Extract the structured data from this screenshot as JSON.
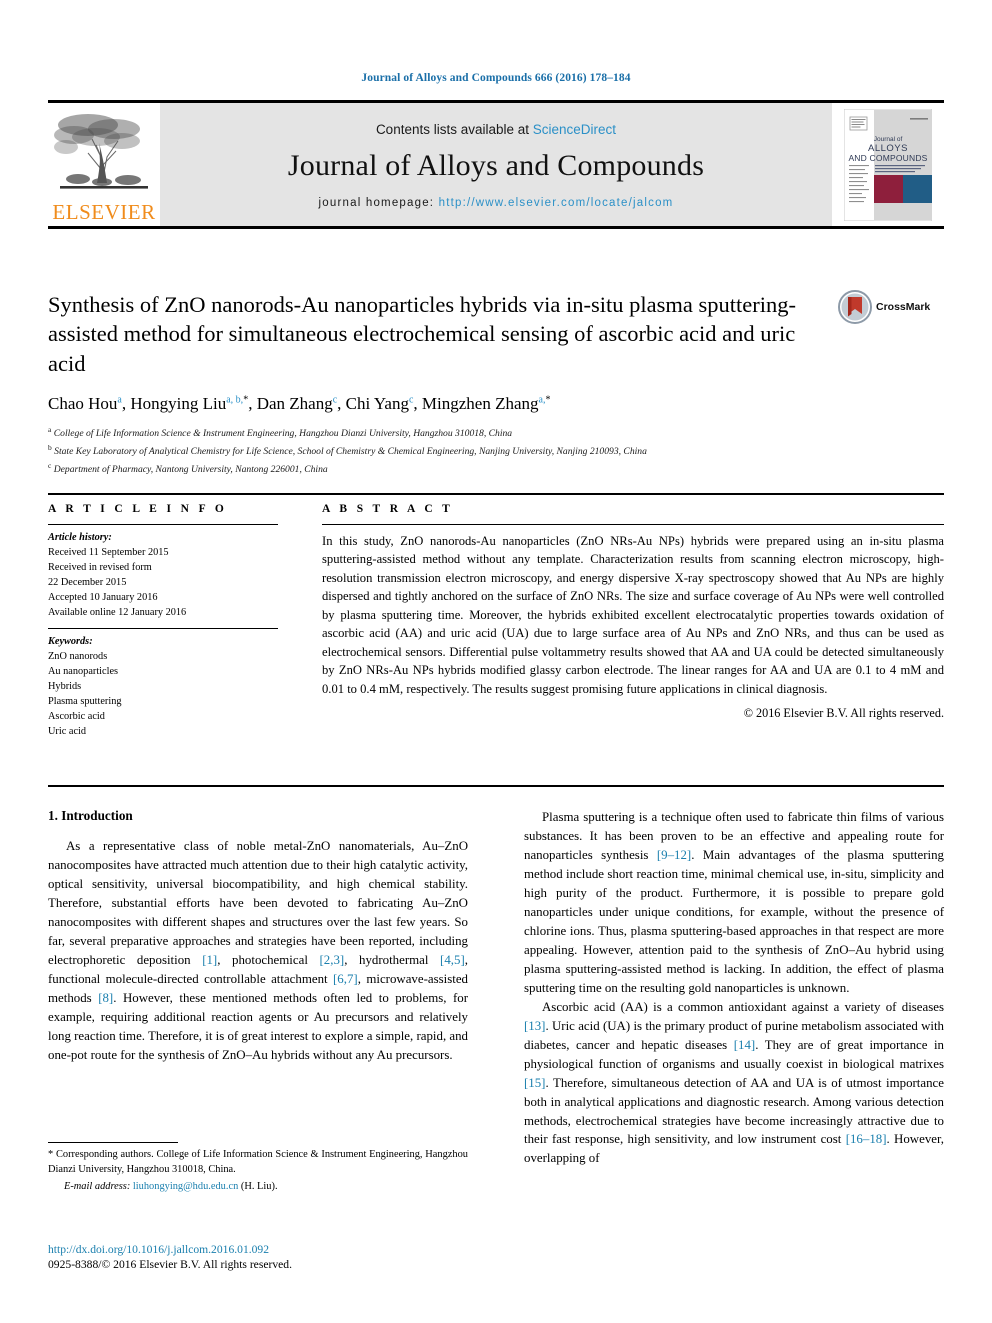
{
  "running_head": "Journal of Alloys and Compounds 666 (2016) 178–184",
  "masthead": {
    "publisher": "ELSEVIER",
    "contents_prefix": "Contents lists available at ",
    "contents_link": "ScienceDirect",
    "journal_title": "Journal of Alloys and Compounds",
    "homepage_label": "journal homepage: ",
    "homepage_url": "http://www.elsevier.com/locate/jalcom",
    "cover": {
      "line1": "Journal of",
      "line2": "ALLOYS",
      "line3": "AND COMPOUNDS"
    }
  },
  "article": {
    "title": "Synthesis of ZnO nanorods-Au nanoparticles hybrids via in-situ plasma sputtering-assisted method for simultaneous electrochemical sensing of ascorbic acid and uric acid",
    "crossmark_label": "CrossMark",
    "authors": [
      {
        "name": "Chao Hou",
        "sup": "a",
        "star": false
      },
      {
        "name": "Hongying Liu",
        "sup": "a, b,",
        "star": true
      },
      {
        "name": "Dan Zhang",
        "sup": "c",
        "star": false
      },
      {
        "name": "Chi Yang",
        "sup": "c",
        "star": false
      },
      {
        "name": "Mingzhen Zhang",
        "sup": "a,",
        "star": true
      }
    ],
    "affiliations": [
      {
        "mark": "a",
        "text": "College of Life Information Science & Instrument Engineering, Hangzhou Dianzi University, Hangzhou 310018, China"
      },
      {
        "mark": "b",
        "text": "State Key Laboratory of Analytical Chemistry for Life Science, School of Chemistry & Chemical Engineering, Nanjing University, Nanjing 210093, China"
      },
      {
        "mark": "c",
        "text": "Department of Pharmacy, Nantong University, Nantong 226001, China"
      }
    ]
  },
  "article_info": {
    "heading": "A R T I C L E  I N F O",
    "history_label": "Article history:",
    "history": [
      "Received 11 September 2015",
      "Received in revised form",
      "22 December 2015",
      "Accepted 10 January 2016",
      "Available online 12 January 2016"
    ],
    "keywords_label": "Keywords:",
    "keywords": [
      "ZnO nanorods",
      "Au nanoparticles",
      "Hybrids",
      "Plasma sputtering",
      "Ascorbic acid",
      "Uric acid"
    ]
  },
  "abstract": {
    "heading": "A B S T R A C T",
    "text": "In this study, ZnO nanorods-Au nanoparticles (ZnO NRs-Au NPs) hybrids were prepared using an in-situ plasma sputtering-assisted method without any template. Characterization results from scanning electron microscopy, high-resolution transmission electron microscopy, and energy dispersive X-ray spectroscopy showed that Au NPs are highly dispersed and tightly anchored on the surface of ZnO NRs. The size and surface coverage of Au NPs were well controlled by plasma sputtering time. Moreover, the hybrids exhibited excellent electrocatalytic properties towards oxidation of ascorbic acid (AA) and uric acid (UA) due to large surface area of Au NPs and ZnO NRs, and thus can be used as electrochemical sensors. Differential pulse voltammetry results showed that AA and UA could be detected simultaneously by ZnO NRs-Au NPs hybrids modified glassy carbon electrode. The linear ranges for AA and UA are 0.1 to 4 mM and 0.01 to 0.4 mM, respectively. The results suggest promising future applications in clinical diagnosis.",
    "copyright": "© 2016 Elsevier B.V. All rights reserved."
  },
  "introduction": {
    "heading": "1. Introduction",
    "left_paragraph_parts": [
      "As a representative class of noble metal-ZnO nanomaterials, Au–ZnO nanocomposites have attracted much attention due to their high catalytic activity, optical sensitivity, universal biocompatibility, and high chemical stability. Therefore, substantial efforts have been devoted to fabricating Au–ZnO nanocomposites with different shapes and structures over the last few years. So far, several preparative approaches and strategies have been reported, including electrophoretic deposition ",
      "[1]",
      ", photochemical ",
      "[2,3]",
      ", hydrothermal ",
      "[4,5]",
      ", functional molecule-directed controllable attachment ",
      "[6,7]",
      ", microwave-assisted methods ",
      "[8]",
      ". However, these mentioned methods often led to problems, for example, requiring additional reaction agents or Au precursors and relatively long reaction time. Therefore, it is of great interest to explore a simple, rapid, and one-pot route for the synthesis of ZnO–Au hybrids without any Au precursors."
    ],
    "right_paragraph1_parts": [
      "Plasma sputtering is a technique often used to fabricate thin films of various substances. It has been proven to be an effective and appealing route for nanoparticles synthesis ",
      "[9–12]",
      ". Main advantages of the plasma sputtering method include short reaction time, minimal chemical use, in-situ, simplicity and high purity of the product. Furthermore, it is possible to prepare gold nanoparticles under unique conditions, for example, without the presence of chlorine ions. Thus, plasma sputtering-based approaches in that respect are more appealing. However, attention paid to the synthesis of ZnO–Au hybrid using plasma sputtering-assisted method is lacking. In addition, the effect of plasma sputtering time on the resulting gold nanoparticles is unknown."
    ],
    "right_paragraph2_parts": [
      "Ascorbic acid (AA) is a common antioxidant against a variety of diseases ",
      "[13]",
      ". Uric acid (UA) is the primary product of purine metabolism associated with diabetes, cancer and hepatic diseases ",
      "[14]",
      ". They are of great importance in physiological function of organisms and usually coexist in biological matrixes ",
      "[15]",
      ". Therefore, simultaneous detection of AA and UA is of utmost importance both in analytical applications and diagnostic research. Among various detection methods, electrochemical strategies have become increasingly attractive due to their fast response, high sensitivity, and low instrument cost ",
      "[16–18]",
      ". However, overlapping of"
    ]
  },
  "footnotes": {
    "corresponding": "* Corresponding authors. College of Life Information Science & Instrument Engineering, Hangzhou Dianzi University, Hangzhou 310018, China.",
    "email_label": "E-mail address:",
    "email": "liuhongying@hdu.edu.cn",
    "email_suffix": "(H. Liu).",
    "doi": "http://dx.doi.org/10.1016/j.jallcom.2016.01.092",
    "issn_line": "0925-8388/© 2016 Elsevier B.V. All rights reserved."
  },
  "colors": {
    "link_blue": "#1a7fae",
    "sciencedirect_blue": "#2b90c7",
    "elsevier_orange": "#f08c1c",
    "band_grey": "#e4e4e4"
  }
}
